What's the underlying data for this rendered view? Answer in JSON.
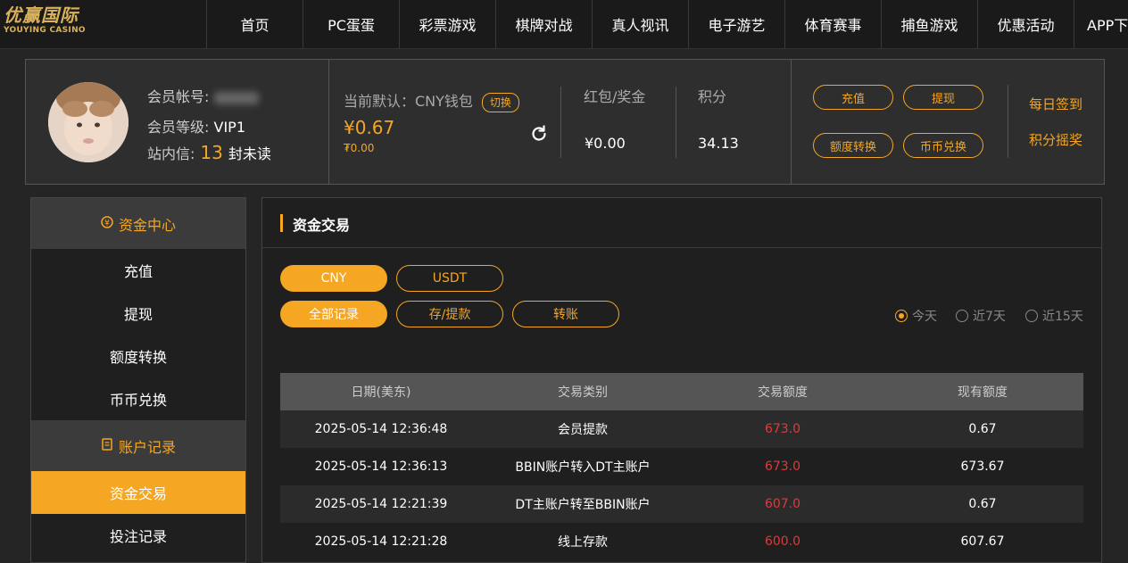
{
  "brand": {
    "logo_cn": "优赢国际",
    "logo_en": "YOUYING CASINO"
  },
  "nav": [
    "首页",
    "PC蛋蛋",
    "彩票游戏",
    "棋牌对战",
    "真人视讯",
    "电子游艺",
    "体育赛事",
    "捕鱼游戏",
    "优惠活动",
    "APP下载"
  ],
  "member": {
    "account_label": "会员帐号:",
    "level_label": "会员等级:",
    "level_value": "VIP1",
    "inbox_label": "站内信:",
    "inbox_count": "13",
    "inbox_suffix": "封未读",
    "wallet_label": "当前默认：CNY钱包",
    "switch_label": "切换",
    "balance": "¥0.67",
    "balance_sub": "₮0.00",
    "bonus_label": "红包/奖金",
    "bonus_value": "¥0.00",
    "points_label": "积分",
    "points_value": "34.13",
    "actions": {
      "deposit": "充值",
      "withdraw": "提现",
      "transfer": "额度转换",
      "exchange": "币币兑换"
    },
    "links": {
      "checkin": "每日签到",
      "lottery": "积分摇奖"
    }
  },
  "sidebar": {
    "funds_head": "资金中心",
    "funds_items": [
      "充值",
      "提现",
      "额度转换",
      "币币兑换"
    ],
    "records_head": "账户记录",
    "records_items": [
      "资金交易",
      "投注记录"
    ]
  },
  "main": {
    "title": "资金交易",
    "currency_tabs": [
      "CNY",
      "USDT"
    ],
    "type_tabs": [
      "全部记录",
      "存/提款",
      "转账"
    ],
    "ranges": [
      "今天",
      "近7天",
      "近15天"
    ],
    "table": {
      "headers": [
        "日期(美东)",
        "交易类别",
        "交易额度",
        "现有额度"
      ],
      "rows": [
        [
          "2025-05-14 12:36:48",
          "会员提款",
          "673.0",
          "0.67"
        ],
        [
          "2025-05-14 12:36:13",
          "BBIN账户转入DT主账户",
          "673.0",
          "673.67"
        ],
        [
          "2025-05-14 12:21:39",
          "DT主账户转至BBIN账户",
          "607.0",
          "0.67"
        ],
        [
          "2025-05-14 12:21:28",
          "线上存款",
          "600.0",
          "607.67"
        ]
      ]
    }
  },
  "colors": {
    "accent": "#f5a623",
    "negative": "#e03a3a",
    "bg": "#252525"
  }
}
